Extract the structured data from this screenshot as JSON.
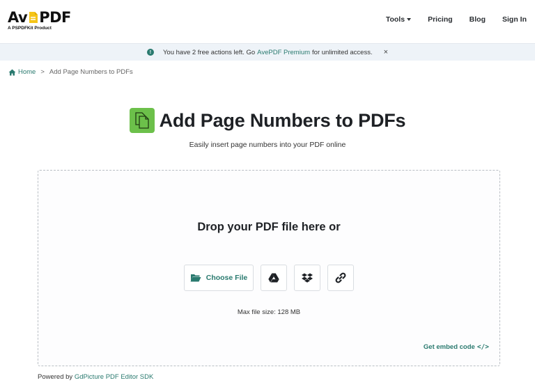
{
  "brand": {
    "logo_part1": "Av",
    "logo_part2": "PDF",
    "tagline": "A PSPDFKit Product"
  },
  "nav": {
    "tools": "Tools",
    "pricing": "Pricing",
    "blog": "Blog",
    "signin": "Sign In"
  },
  "notice": {
    "text_before": "You have 2 free actions left. Go",
    "link": "AvePDF Premium",
    "text_after": "for unlimited access.",
    "close": "×"
  },
  "breadcrumb": {
    "home": "Home",
    "separator": ">",
    "current": "Add Page Numbers to PDFs"
  },
  "page": {
    "title": "Add Page Numbers to PDFs",
    "subtitle": "Easily insert page numbers into your PDF online"
  },
  "dropzone": {
    "heading": "Drop your PDF file here or",
    "choose_file": "Choose File",
    "max_size": "Max file size: 128 MB",
    "embed": "Get embed code",
    "embed_icon": "</>"
  },
  "footer": {
    "powered_prefix": "Powered by",
    "powered_link": "GdPicture PDF Editor SDK"
  },
  "colors": {
    "accent": "#2a7a6f",
    "tool_icon_bg": "#6cc04a",
    "notice_bg": "#eef3f8"
  },
  "icons": {
    "notice": "info-icon",
    "home": "home-icon",
    "tool": "files-icon",
    "choose": "folder-open-icon",
    "drive": "google-drive-icon",
    "dropbox": "dropbox-icon",
    "link": "link-icon"
  }
}
